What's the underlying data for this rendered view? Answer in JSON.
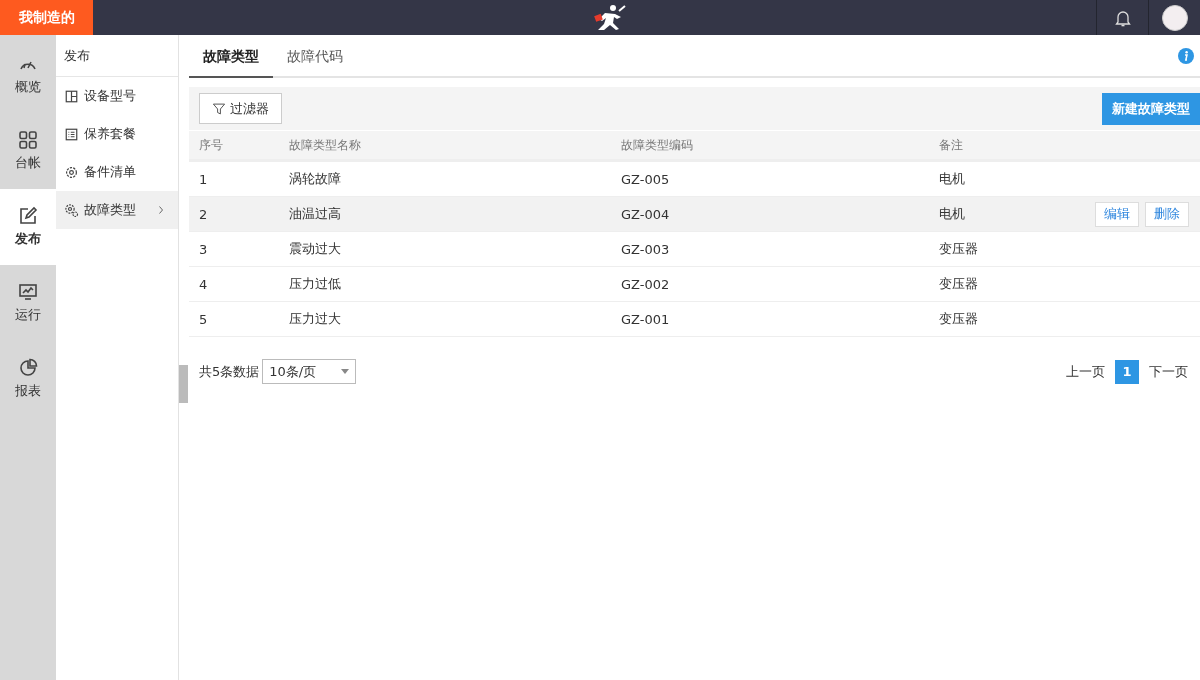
{
  "brand": "我制造的",
  "rail": [
    {
      "kind": "gauge",
      "label": "概览",
      "selected": false
    },
    {
      "kind": "grid",
      "label": "台帐",
      "selected": false
    },
    {
      "kind": "edit",
      "label": "发布",
      "selected": true
    },
    {
      "kind": "monitor",
      "label": "运行",
      "selected": false
    },
    {
      "kind": "pie",
      "label": "报表",
      "selected": false
    }
  ],
  "submenu": {
    "title": "发布",
    "items": [
      {
        "kind": "layout",
        "label": "设备型号",
        "selected": false
      },
      {
        "kind": "list",
        "label": "保养套餐",
        "selected": false
      },
      {
        "kind": "gear",
        "label": "备件清单",
        "selected": false
      },
      {
        "kind": "gears",
        "label": "故障类型",
        "selected": true
      }
    ]
  },
  "tabs": [
    {
      "label": "故障类型",
      "selected": true
    },
    {
      "label": "故障代码",
      "selected": false
    }
  ],
  "toolbar": {
    "filter": "过滤器",
    "create": "新建故障类型"
  },
  "table": {
    "columns": [
      "序号",
      "故障类型名称",
      "故障类型编码",
      "备注"
    ],
    "rows": [
      {
        "cells": [
          "1",
          "涡轮故障",
          "GZ-005",
          "电机"
        ],
        "hovered": false
      },
      {
        "cells": [
          "2",
          "油温过高",
          "GZ-004",
          "电机"
        ],
        "hovered": true,
        "actions": [
          "编辑",
          "删除"
        ]
      },
      {
        "cells": [
          "3",
          "震动过大",
          "GZ-003",
          "变压器"
        ],
        "hovered": false
      },
      {
        "cells": [
          "4",
          "压力过低",
          "GZ-002",
          "变压器"
        ],
        "hovered": false
      },
      {
        "cells": [
          "5",
          "压力过大",
          "GZ-001",
          "变压器"
        ],
        "hovered": false
      }
    ]
  },
  "footer": {
    "total": "共5条数据",
    "page_size": "10条/页",
    "prev": "上一页",
    "pages": [
      {
        "label": "1",
        "selected": true
      }
    ],
    "next": "下一页"
  }
}
